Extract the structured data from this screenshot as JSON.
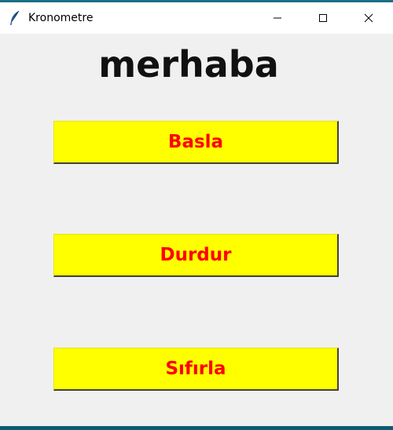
{
  "window": {
    "title": "Kronometre",
    "app_icon": "feather-icon",
    "controls": {
      "minimize_icon": "minimize-icon",
      "maximize_icon": "maximize-icon",
      "close_icon": "close-icon"
    }
  },
  "main": {
    "heading": "merhaba",
    "buttons": {
      "start": "Basla",
      "stop": "Durdur",
      "reset": "Sıfırla"
    }
  },
  "colors": {
    "button_background": "#ffff00",
    "button_text": "#ff0000",
    "window_background": "#f0f0f0",
    "heading_text": "#111111"
  }
}
